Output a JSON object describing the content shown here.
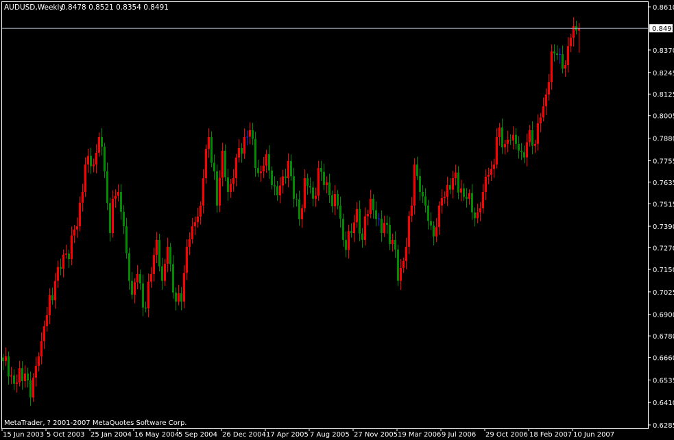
{
  "header": {
    "symbol_timeframe": "AUDUSD,Weekly",
    "ohlc_text": "0.8478 0.8521 0.8354 0.8491"
  },
  "footer": {
    "copyright": "MetaTrader, ? 2001-2007 MetaQuotes Software Corp."
  },
  "colors": {
    "background": "#000000",
    "bull": "#ff0000",
    "bear": "#008c00",
    "doji": "#2020ff",
    "axis": "#ffffff",
    "price_line": "#a8b0c0"
  },
  "chart_data": {
    "type": "candlestick",
    "title": "AUDUSD,Weekly",
    "ylim": [
      0.6285,
      0.861
    ],
    "y_ticks": [
      "0.8610",
      "0.8370",
      "0.8245",
      "0.8125",
      "0.8005",
      "0.7880",
      "0.7755",
      "0.7635",
      "0.7515",
      "0.7390",
      "0.7270",
      "0.7150",
      "0.7025",
      "0.6900",
      "0.6780",
      "0.6660",
      "0.6535",
      "0.6410",
      "0.6285"
    ],
    "current_price": "0.8491",
    "x_ticks": [
      {
        "week": 0,
        "label": "15 Jun 2003"
      },
      {
        "week": 16,
        "label": "5 Oct 2003"
      },
      {
        "week": 32,
        "label": "25 Jan 2004"
      },
      {
        "week": 48,
        "label": "16 May 2004"
      },
      {
        "week": 64,
        "label": "5 Sep 2004"
      },
      {
        "week": 80,
        "label": "26 Dec 2004"
      },
      {
        "week": 96,
        "label": "17 Apr 2005"
      },
      {
        "week": 112,
        "label": "7 Aug 2005"
      },
      {
        "week": 128,
        "label": "27 Nov 2005"
      },
      {
        "week": 144,
        "label": "19 Mar 2006"
      },
      {
        "week": 160,
        "label": "9 Jul 2006"
      },
      {
        "week": 176,
        "label": "29 Oct 2006"
      },
      {
        "week": 192,
        "label": "18 Feb 2007"
      },
      {
        "week": 208,
        "label": "10 Jun 2007"
      }
    ],
    "weeks": 211,
    "last_candle": {
      "open": 0.8478,
      "high": 0.8521,
      "low": 0.8354,
      "close": 0.8491
    },
    "close_anchors": [
      [
        0,
        0.664
      ],
      [
        1,
        0.6666
      ],
      [
        4,
        0.6514
      ],
      [
        8,
        0.6571
      ],
      [
        10,
        0.6438
      ],
      [
        13,
        0.6666
      ],
      [
        16,
        0.6895
      ],
      [
        19,
        0.7086
      ],
      [
        23,
        0.7238
      ],
      [
        27,
        0.739
      ],
      [
        29,
        0.7581
      ],
      [
        30,
        0.7733
      ],
      [
        33,
        0.7733
      ],
      [
        35,
        0.7886
      ],
      [
        37,
        0.7695
      ],
      [
        39,
        0.7352
      ],
      [
        40,
        0.7543
      ],
      [
        42,
        0.7581
      ],
      [
        44,
        0.739
      ],
      [
        47,
        0.7009
      ],
      [
        49,
        0.7124
      ],
      [
        52,
        0.6933
      ],
      [
        54,
        0.7124
      ],
      [
        56,
        0.7314
      ],
      [
        58,
        0.7086
      ],
      [
        60,
        0.7276
      ],
      [
        63,
        0.6971
      ],
      [
        65,
        0.6971
      ],
      [
        67,
        0.7276
      ],
      [
        69,
        0.739
      ],
      [
        72,
        0.7505
      ],
      [
        73,
        0.7657
      ],
      [
        75,
        0.7886
      ],
      [
        77,
        0.7695
      ],
      [
        78,
        0.7505
      ],
      [
        80,
        0.781
      ],
      [
        82,
        0.7581
      ],
      [
        84,
        0.7657
      ],
      [
        85,
        0.7772
      ],
      [
        88,
        0.7886
      ],
      [
        90,
        0.7924
      ],
      [
        92,
        0.7714
      ],
      [
        94,
        0.7695
      ],
      [
        96,
        0.7791
      ],
      [
        98,
        0.7619
      ],
      [
        100,
        0.7562
      ],
      [
        103,
        0.7657
      ],
      [
        104,
        0.7753
      ],
      [
        106,
        0.7543
      ],
      [
        108,
        0.7429
      ],
      [
        110,
        0.7657
      ],
      [
        113,
        0.7543
      ],
      [
        115,
        0.7714
      ],
      [
        117,
        0.7619
      ],
      [
        119,
        0.7562
      ],
      [
        122,
        0.7505
      ],
      [
        124,
        0.7314
      ],
      [
        127,
        0.7352
      ],
      [
        129,
        0.7486
      ],
      [
        131,
        0.7314
      ],
      [
        134,
        0.7543
      ],
      [
        136,
        0.7429
      ],
      [
        138,
        0.7352
      ],
      [
        139,
        0.7409
      ],
      [
        142,
        0.7314
      ],
      [
        144,
        0.7086
      ],
      [
        147,
        0.7276
      ],
      [
        149,
        0.7505
      ],
      [
        150,
        0.7733
      ],
      [
        152,
        0.7581
      ],
      [
        154,
        0.7505
      ],
      [
        157,
        0.7333
      ],
      [
        159,
        0.7505
      ],
      [
        162,
        0.7619
      ],
      [
        164,
        0.7657
      ],
      [
        167,
        0.76
      ],
      [
        169,
        0.7543
      ],
      [
        171,
        0.7467
      ],
      [
        173,
        0.7467
      ],
      [
        175,
        0.7581
      ],
      [
        177,
        0.7676
      ],
      [
        179,
        0.7733
      ],
      [
        180,
        0.7886
      ],
      [
        183,
        0.7848
      ],
      [
        185,
        0.7867
      ],
      [
        188,
        0.781
      ],
      [
        190,
        0.7772
      ],
      [
        192,
        0.7924
      ],
      [
        194,
        0.7848
      ],
      [
        195,
        0.7962
      ],
      [
        197,
        0.8057
      ],
      [
        199,
        0.8191
      ],
      [
        200,
        0.8362
      ],
      [
        202,
        0.8343
      ],
      [
        204,
        0.8267
      ],
      [
        205,
        0.8286
      ],
      [
        207,
        0.8438
      ],
      [
        209,
        0.8478
      ],
      [
        210,
        0.8491
      ]
    ]
  }
}
